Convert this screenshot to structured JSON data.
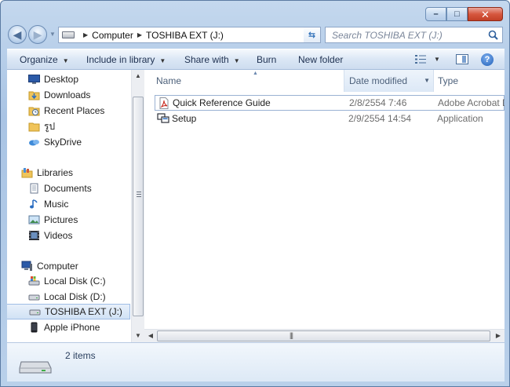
{
  "window": {
    "caption": {
      "minimize": "–",
      "maximize": "□",
      "close": "✕"
    }
  },
  "address": {
    "crumbs": [
      "Computer",
      "TOSHIBA EXT (J:)"
    ]
  },
  "search": {
    "placeholder": "Search TOSHIBA EXT (J:)"
  },
  "toolbar": {
    "organize": "Organize",
    "include_in_library": "Include in library",
    "share_with": "Share with",
    "burn": "Burn",
    "new_folder": "New folder"
  },
  "nav": {
    "favorites": [
      {
        "label": "Desktop",
        "icon": "desktop-icon"
      },
      {
        "label": "Downloads",
        "icon": "downloads-folder-icon"
      },
      {
        "label": "Recent Places",
        "icon": "recent-places-icon"
      },
      {
        "label": "รูป",
        "icon": "folder-icon"
      },
      {
        "label": "SkyDrive",
        "icon": "skydrive-icon"
      }
    ],
    "libraries": {
      "label": "Libraries",
      "items": [
        {
          "label": "Documents",
          "icon": "documents-icon"
        },
        {
          "label": "Music",
          "icon": "music-icon"
        },
        {
          "label": "Pictures",
          "icon": "pictures-icon"
        },
        {
          "label": "Videos",
          "icon": "videos-icon"
        }
      ]
    },
    "computer": {
      "label": "Computer",
      "items": [
        {
          "label": "Local Disk (C:)",
          "icon": "system-drive-icon"
        },
        {
          "label": "Local Disk (D:)",
          "icon": "drive-icon"
        },
        {
          "label": "TOSHIBA EXT (J:)",
          "icon": "drive-icon",
          "selected": true
        },
        {
          "label": "Apple iPhone",
          "icon": "iphone-icon"
        }
      ]
    }
  },
  "columns": {
    "name": "Name",
    "date_modified": "Date modified",
    "type": "Type"
  },
  "files": [
    {
      "name": "Quick Reference Guide",
      "date": "2/8/2554 7:46",
      "type": "Adobe Acrobat D",
      "icon": "pdf-icon"
    },
    {
      "name": "Setup",
      "date": "2/9/2554 14:54",
      "type": "Application",
      "icon": "setup-application-icon"
    }
  ],
  "status": {
    "count": "2 items"
  },
  "colors": {
    "accent": "#2e6fb8",
    "selection": "#d1e2f5"
  }
}
